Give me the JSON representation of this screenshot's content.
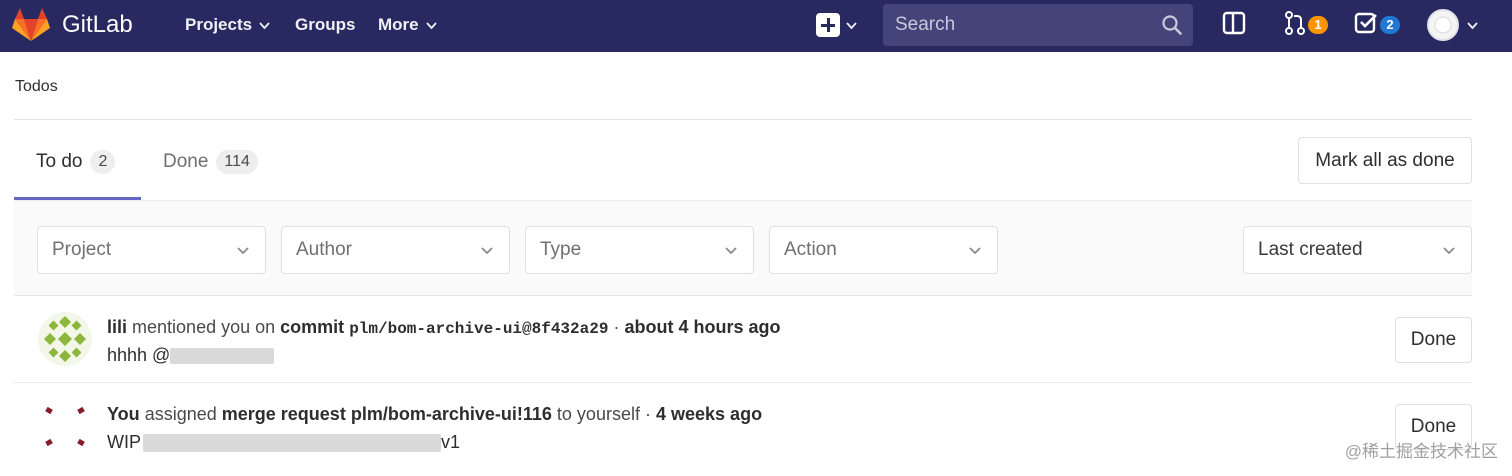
{
  "navbar": {
    "brand": "GitLab",
    "links": [
      {
        "label": "Projects",
        "has_dropdown": true
      },
      {
        "label": "Groups",
        "has_dropdown": false
      },
      {
        "label": "More",
        "has_dropdown": true
      }
    ],
    "search_placeholder": "Search",
    "merge_requests_count": "1",
    "todos_count": "2",
    "icons": [
      "gitlab-logo-icon",
      "plus-icon",
      "search-icon",
      "sidebar-toggle-icon",
      "merge-request-icon",
      "todo-check-icon",
      "user-avatar"
    ],
    "colors": {
      "background": "#292961",
      "search_bg": "#44447a",
      "badge_orange": "#fc9403",
      "badge_blue": "#1f78d1"
    }
  },
  "breadcrumb": "Todos",
  "tabs": [
    {
      "label": "To do",
      "count": "2",
      "active": true
    },
    {
      "label": "Done",
      "count": "114",
      "active": false
    }
  ],
  "mark_all_label": "Mark all as done",
  "filters": [
    {
      "label": "Project"
    },
    {
      "label": "Author"
    },
    {
      "label": "Type"
    },
    {
      "label": "Action"
    }
  ],
  "sort": {
    "selected": "Last created"
  },
  "todos": [
    {
      "author": "lili",
      "action": "mentioned you on",
      "target_type": "commit",
      "target_ref": "plm/bom-archive-ui@8f432a29",
      "separator": "·",
      "time": "about 4 hours ago",
      "body_text": "hhhh @",
      "done_label": "Done"
    },
    {
      "author": "You",
      "action": "assigned",
      "target_type": "merge request",
      "target_ref": "plm/bom-archive-ui!116",
      "suffix": "to yourself",
      "separator": "·",
      "time": "4 weeks ago",
      "body_text": "WIP",
      "body_tail": "v1",
      "done_label": "Done"
    }
  ],
  "watermark": "@稀土掘金技术社区"
}
